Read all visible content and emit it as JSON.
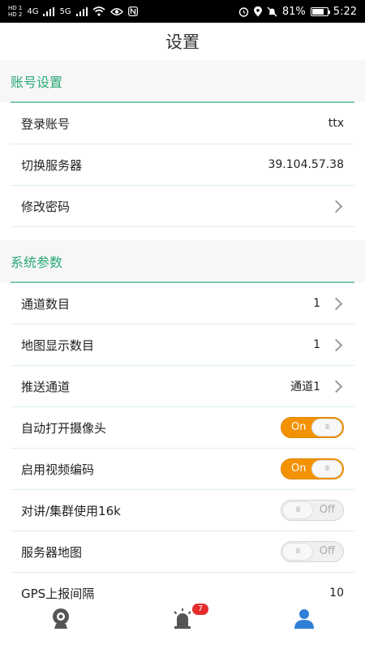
{
  "status_bar": {
    "hd1": "HD 1",
    "hd2": "HD 2",
    "signal1": "4G",
    "signal2": "5G",
    "battery_percent": "81%",
    "battery_level": 0.81,
    "time": "5:22"
  },
  "header": {
    "title": "设置"
  },
  "sections": {
    "account": {
      "title": "账号设置",
      "rows": {
        "login": {
          "label": "登录账号",
          "value": "ttx"
        },
        "server": {
          "label": "切换服务器",
          "value": "39.104.57.38"
        },
        "password": {
          "label": "修改密码"
        }
      }
    },
    "system": {
      "title": "系统参数",
      "rows": {
        "channel_count": {
          "label": "通道数目",
          "value": "1"
        },
        "map_count": {
          "label": "地图显示数目",
          "value": "1"
        },
        "push_channel": {
          "label": "推送通道",
          "value": "通道1"
        },
        "auto_camera": {
          "label": "自动打开摄像头",
          "state": "On",
          "knob": "III"
        },
        "video_encode": {
          "label": "启用视频编码",
          "state": "On",
          "knob": "III"
        },
        "intercom16k": {
          "label": "对讲/集群使用16k",
          "state": "Off",
          "knob": "III"
        },
        "server_map": {
          "label": "服务器地图",
          "state": "Off",
          "knob": "III"
        },
        "gps_interval": {
          "label": "GPS上报间隔",
          "value": "10"
        }
      }
    }
  },
  "bottom_nav": {
    "alarm_badge": "7",
    "active_color": "#2f7fd6"
  },
  "colors": {
    "accent": "#2aa877",
    "toggle_on": "#f39200"
  }
}
